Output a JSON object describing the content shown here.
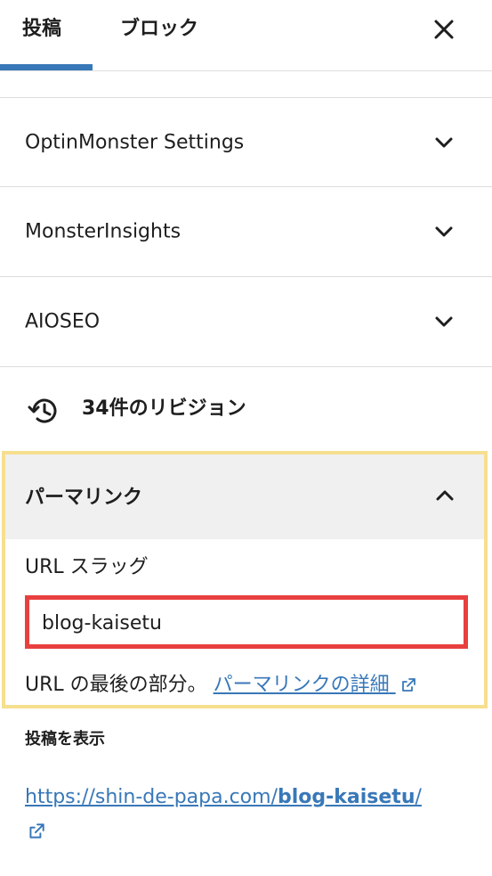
{
  "tabs": [
    {
      "label": "投稿",
      "active": true
    },
    {
      "label": "ブロック",
      "active": false
    }
  ],
  "panels": [
    {
      "title": "OptinMonster Settings"
    },
    {
      "title": "MonsterInsights"
    },
    {
      "title": "AIOSEO"
    }
  ],
  "revisions": {
    "label": "34件のリビジョン",
    "icon": "history-icon"
  },
  "permalink": {
    "title": "パーマリンク",
    "slug_label": "URL スラッグ",
    "slug_value": "blog-kaisetu",
    "help_text": "URL の最後の部分。",
    "help_link": "パーマリンクの詳細",
    "view_heading": "投稿を表示",
    "post_url_base": "https://shin-de-papa.com/",
    "post_url_slug": "blog-kaisetu",
    "post_url_trail": "/"
  },
  "colors": {
    "accent": "#3878b8",
    "highlight_border": "#f6df8f",
    "slug_border": "#e8403f",
    "header_bg": "#f0f0f0"
  }
}
